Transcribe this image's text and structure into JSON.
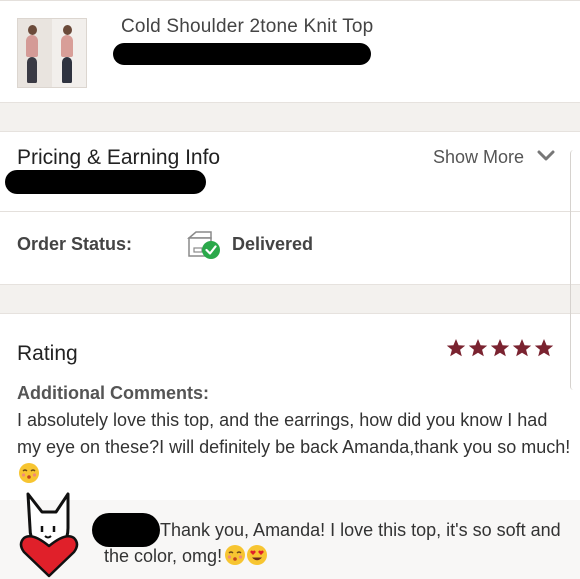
{
  "product": {
    "title": "Cold Shoulder 2tone Knit Top",
    "thumbnail_icon": "product-photo"
  },
  "pricing": {
    "title": "Pricing & Earning Info",
    "show_more_label": "Show More",
    "chevron_icon": "chevron-down-icon"
  },
  "order": {
    "status_label": "Order Status:",
    "status_value": "Delivered",
    "status_icon": "box-check-icon",
    "status_color": "#2aa84a"
  },
  "rating": {
    "title": "Rating",
    "stars": 5,
    "star_color": "#7a2330",
    "comments_label": "Additional Comments:",
    "comment_text": "I absolutely love this top, and the earrings, how did you know I had my eye on these?I will definitely be back Amanda,thank you so much!"
  },
  "reply": {
    "text": "Thank you, Amanda! I love this top, it's so soft and the color, omg!",
    "avatar_icon": "cat-with-heart-sticker"
  },
  "colors": {
    "band": "#f3f1ee",
    "accent": "#7a2330",
    "heart": "#e0202a"
  }
}
